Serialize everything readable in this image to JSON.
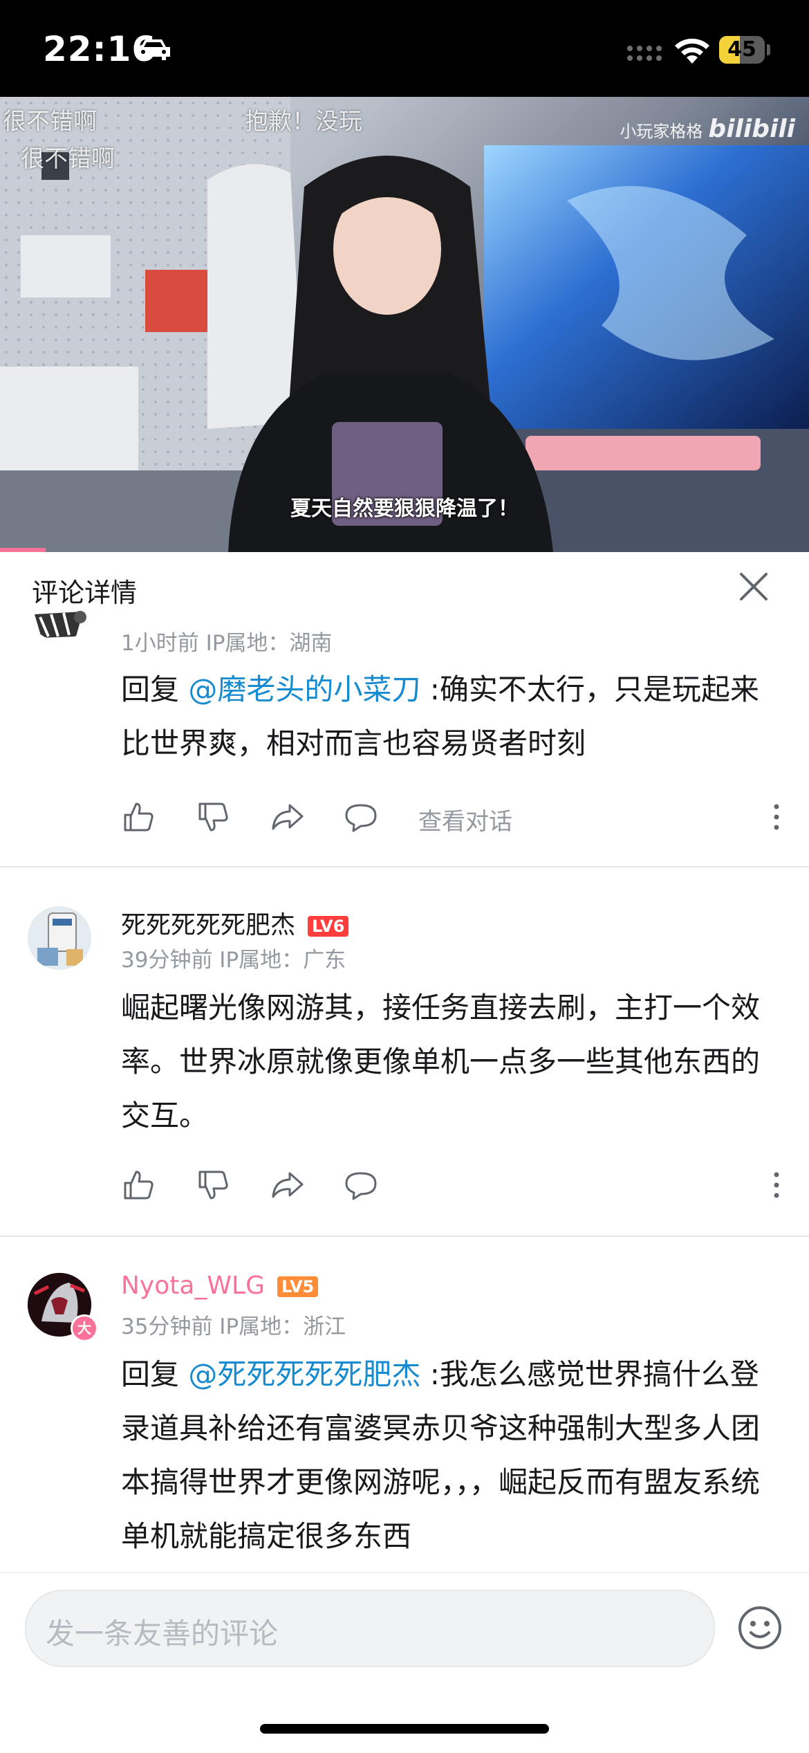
{
  "status_bar": {
    "time": "22:16",
    "battery": "45",
    "battery_level": 0.45
  },
  "video": {
    "danmaku": [
      "很不错啊",
      "很不错啊",
      "抱歉！没玩"
    ],
    "watermark_text": "小玩家格格",
    "watermark_logo": "bilibili",
    "subtitle": "夏天自然要狠狠降温了！",
    "progress": 0.056
  },
  "panel": {
    "title": "评论详情",
    "close_icon": "close-icon"
  },
  "comments": [
    {
      "meta": "1小时前  IP属地：湖南",
      "reply_prefix": "回复 ",
      "mention": "@磨老头的小菜刀",
      "text": " :确实不太行，只是玩起来比世界爽，相对而言也容易贤者时刻",
      "view_conversation": "查看对话"
    },
    {
      "username": "死死死死死肥杰",
      "level": "LV6",
      "meta": "39分钟前  IP属地：广东",
      "text": "崛起曙光像网游其，接任务直接去刷，主打一个效率。世界冰原就像更像单机一点多一些其他东西的交互。"
    },
    {
      "username": "Nyota_WLG",
      "level": "LV5",
      "meta": "35分钟前  IP属地：浙江",
      "reply_prefix": "回复 ",
      "mention": "@死死死死死肥杰",
      "text": " :我怎么感觉世界搞什么登录道具补给还有富婆冥赤贝爷这种强制大型多人团本搞得世界才更像网游呢，，，崛起反而有盟友系统单机就能搞定很多东西",
      "badge": "大"
    }
  ],
  "input": {
    "placeholder": "发一条友善的评论"
  },
  "colors": {
    "accent_pink": "#fb7299",
    "mention_blue": "#178bcf",
    "meta_gray": "#9499a0"
  }
}
